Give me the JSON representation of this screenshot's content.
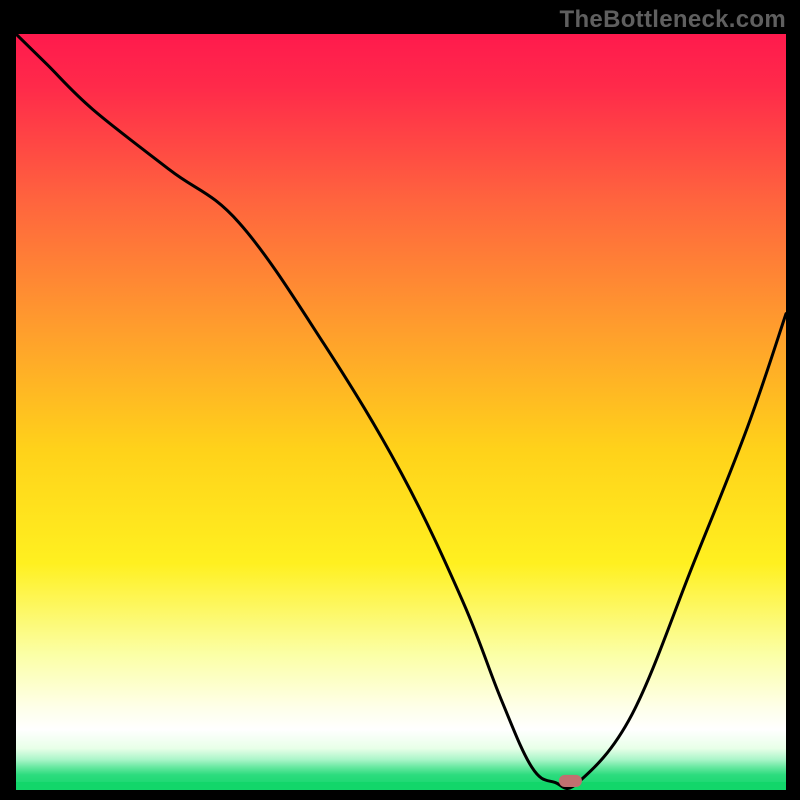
{
  "watermark": "TheBottleneck.com",
  "chart_data": {
    "type": "line",
    "title": "",
    "xlabel": "",
    "ylabel": "",
    "xlim": [
      0,
      100
    ],
    "ylim": [
      0,
      100
    ],
    "grid": false,
    "legend": false,
    "gradient_colors": {
      "top": "#ff1a4d",
      "mid_upper": "#ffa000",
      "mid": "#ffe500",
      "mid_lower": "#f9ffb0",
      "low_band": "#ffffff",
      "bottom": "#12d66a"
    },
    "series": [
      {
        "name": "curve",
        "stroke": "#000000",
        "x": [
          0,
          4,
          10,
          20,
          29,
          40,
          50,
          58,
          63,
          67,
          70,
          73,
          80,
          88,
          95,
          100
        ],
        "y": [
          100,
          96,
          90,
          82,
          75,
          59,
          42,
          25,
          12,
          3,
          1,
          1,
          10,
          30,
          48,
          63
        ],
        "_comment": "y is percent height from bottom; x is percent from left; values estimated from pixels"
      }
    ],
    "marker": {
      "name": "optimal-point",
      "x": 72,
      "y": 1.2,
      "fill_rgb": "#c07070",
      "shape": "rounded-rect",
      "width_pct": 3.0,
      "height_pct": 1.6
    }
  }
}
